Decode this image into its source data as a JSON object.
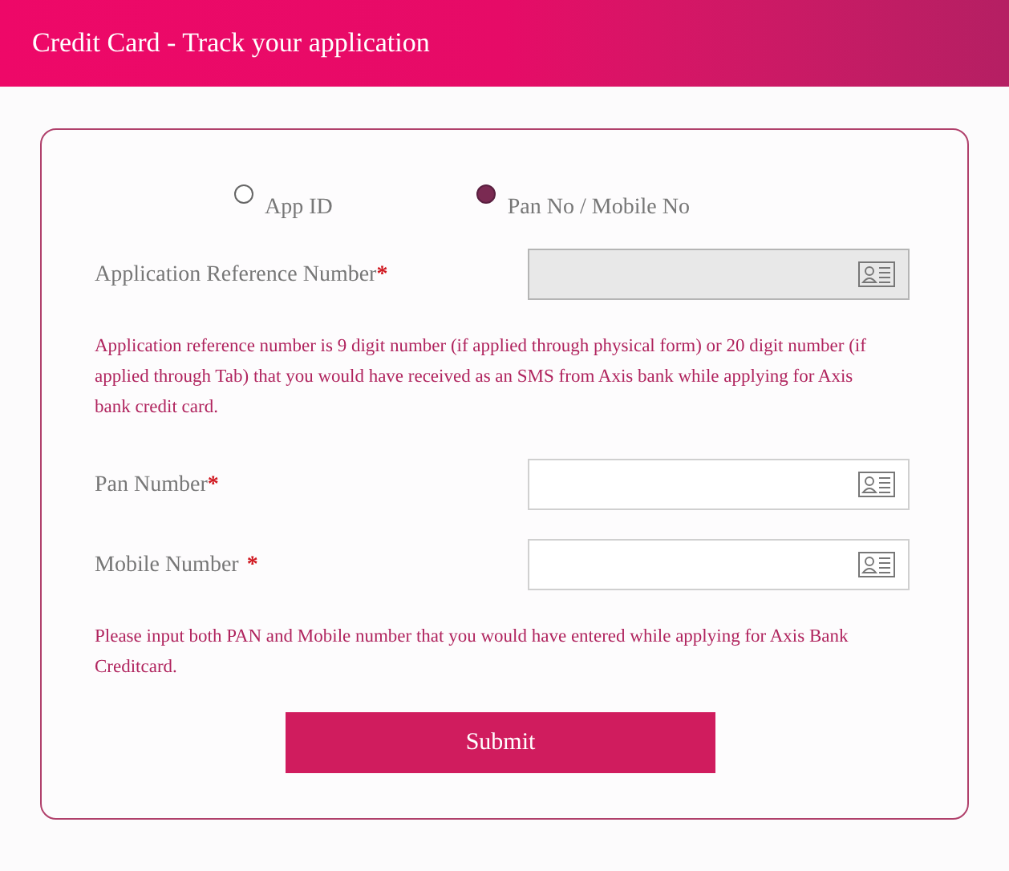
{
  "header": {
    "title": "Credit Card - Track your application"
  },
  "radios": [
    {
      "label": "App ID",
      "selected": false
    },
    {
      "label": "Pan No / Mobile No",
      "selected": true
    }
  ],
  "sections": [
    {
      "kind": "field",
      "label": "Application Reference Number",
      "mark": "*",
      "spaced": false,
      "disabled": true
    },
    {
      "kind": "note",
      "text": "Application reference number is 9 digit number (if applied through physical form) or 20 digit number (if applied through Tab) that you would have received as an SMS from Axis bank while applying for Axis bank credit card."
    },
    {
      "kind": "field",
      "label": "Pan Number",
      "mark": "*",
      "spaced": false,
      "disabled": false
    },
    {
      "kind": "field",
      "label": "Mobile Number",
      "mark": "*",
      "spaced": true,
      "disabled": false
    },
    {
      "kind": "note",
      "text": "Please input both PAN and Mobile number that you would have entered while applying for Axis Bank Creditcard."
    }
  ],
  "submit": {
    "label": "Submit"
  }
}
